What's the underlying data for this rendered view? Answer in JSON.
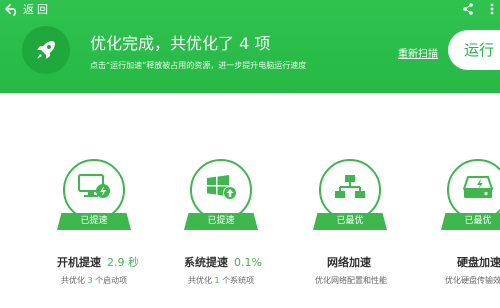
{
  "top_bar": {
    "back_label": "返回",
    "share_icon": "share-icon",
    "more_icon": "more-icon"
  },
  "header": {
    "headline": "优化完成，共优化了 4 项",
    "subline": "点击“运行加速”释放被占用的资源，进一步提升电脑运行速度",
    "rescan_label": "重新扫描",
    "run_label": "运行",
    "bg_color": "#2fc34e",
    "accent_color": "#3cb84d"
  },
  "cards": [
    {
      "icon": "monitor-bolt-icon",
      "badge": "已提速",
      "title": "开机提速",
      "value": "2.9 秒",
      "desc_prefix": "共优化 ",
      "desc_count": "3",
      "desc_suffix": " 个启动项"
    },
    {
      "icon": "windows-up-icon",
      "badge": "已提速",
      "title": "系统提速",
      "value": "0.1%",
      "desc_prefix": "共优化 ",
      "desc_count": "1",
      "desc_suffix": " 个系统项"
    },
    {
      "icon": "network-icon",
      "badge": "已最优",
      "title": "网络加速",
      "value": "",
      "desc_prefix": "优化网络配置和性能",
      "desc_count": "",
      "desc_suffix": ""
    },
    {
      "icon": "hard-disk-icon",
      "badge": "已最优",
      "title": "硬盘加速",
      "value": "",
      "desc_prefix": "优化硬盘传输效",
      "desc_count": "",
      "desc_suffix": ""
    }
  ]
}
